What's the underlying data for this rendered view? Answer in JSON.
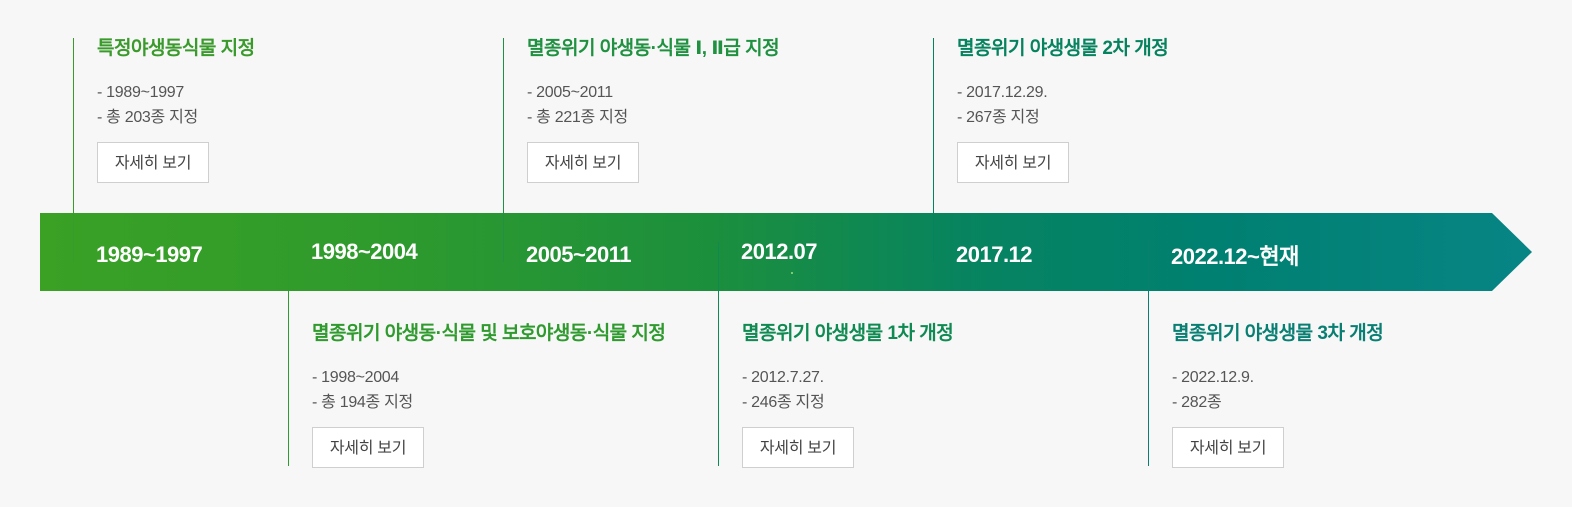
{
  "colors": {
    "bar_start": "#3aa125",
    "bar_end": "#078585",
    "background": "#f7f7f7",
    "year_text": "#ffffff"
  },
  "events": [
    {
      "year": "1989~1997",
      "title": "특정야생동식물 지정",
      "lines": [
        "- 1989~1997",
        "- 총 203종 지정"
      ],
      "button": "자세히 보기",
      "position": "top",
      "color": "#3a9a2c"
    },
    {
      "year": "1998~2004",
      "title": "멸종위기 야생동·식물 및 보호야생동·식물 지정",
      "lines": [
        "- 1998~2004",
        "- 총 194종 지정"
      ],
      "button": "자세히 보기",
      "position": "bottom",
      "color": "#2f9a2e"
    },
    {
      "year": "2005~2011",
      "title": "멸종위기 야생동·식물 Ⅰ, Ⅱ급 지정",
      "lines": [
        "- 2005~2011",
        "- 총 221종 지정"
      ],
      "button": "자세히 보기",
      "position": "top",
      "color": "#1f9140"
    },
    {
      "year": "2012.07",
      "title": "멸종위기 야생생물 1차 개정",
      "lines": [
        "- 2012.7.27.",
        "- 246종 지정"
      ],
      "button": "자세히 보기",
      "position": "bottom",
      "color": "#0f8a52"
    },
    {
      "year": "2017.12",
      "title": "멸종위기 야생생물 2차 개정",
      "lines": [
        "- 2017.12.29.",
        "- 267종 지정"
      ],
      "button": "자세히 보기",
      "position": "top",
      "color": "#06825f"
    },
    {
      "year": "2022.12~현재",
      "title": "멸종위기 야생생물 3차 개정",
      "lines": [
        "- 2022.12.9.",
        "- 282종"
      ],
      "button": "자세히 보기",
      "position": "bottom",
      "color": "#097f73"
    }
  ]
}
